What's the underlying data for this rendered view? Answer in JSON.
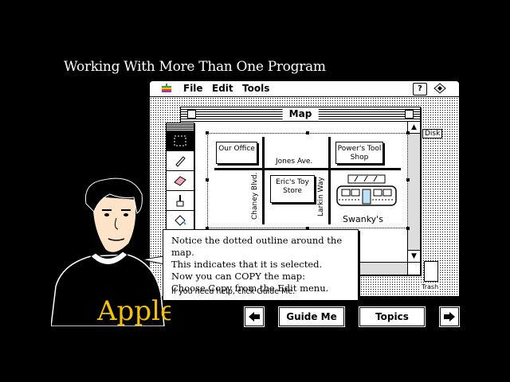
{
  "heading": "Working With More Than One Program",
  "menubar": {
    "items": [
      "File",
      "Edit",
      "Tools"
    ],
    "help_icon": "help-icon",
    "app_icon": "application-icon"
  },
  "window": {
    "title": "Map"
  },
  "map": {
    "buildings": [
      "Our Office",
      "Power's Tool Shop",
      "Eric's Toy Store"
    ],
    "streets": {
      "horizontal": "Jones Ave.",
      "left_vertical": "Chaney Blvd.",
      "right_vertical": "Larkin Way"
    },
    "landmark": "Swanky's"
  },
  "desktop": {
    "disk_label": "Disk",
    "trash_label": "Trash"
  },
  "instructions": {
    "lines": [
      "Notice the dotted outline around the map.",
      "This indicates that it is selected.",
      "Now you can COPY the map:",
      "Choose Copy from the Edit menu."
    ],
    "hint": "If you need help, click Guide Me."
  },
  "nav": {
    "guide_me": "Guide Me",
    "topics": "Topics",
    "back_icon": "left-arrow-icon",
    "forward_icon": "right-arrow-icon"
  },
  "shirt_text": "Apple"
}
